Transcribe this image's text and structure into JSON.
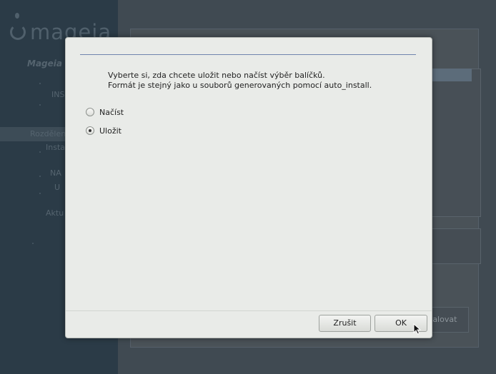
{
  "background": {
    "logo_text": "mageia",
    "sidebar_title": "Mageia",
    "sidebar_steps": [
      "INS",
      "Rozdělen",
      "Insta",
      "NA",
      "U",
      "Aktu"
    ],
    "background_button_label": "talovat"
  },
  "dialog": {
    "message_line_1": "Vyberte si, zda chcete uložit nebo načíst výběr balíčků.",
    "message_line_2": "Formát je stejný jako u souborů generovaných pomocí auto_install.",
    "options": [
      {
        "label": "Načíst",
        "checked": false
      },
      {
        "label": "Uložit",
        "checked": true
      }
    ],
    "cancel_label": "Zrušit",
    "ok_label": "OK"
  },
  "colors": {
    "accent_rule": "#6f84ad",
    "dialog_bg": "#e9ebe8",
    "sidebar_bg": "#2b3b47"
  }
}
